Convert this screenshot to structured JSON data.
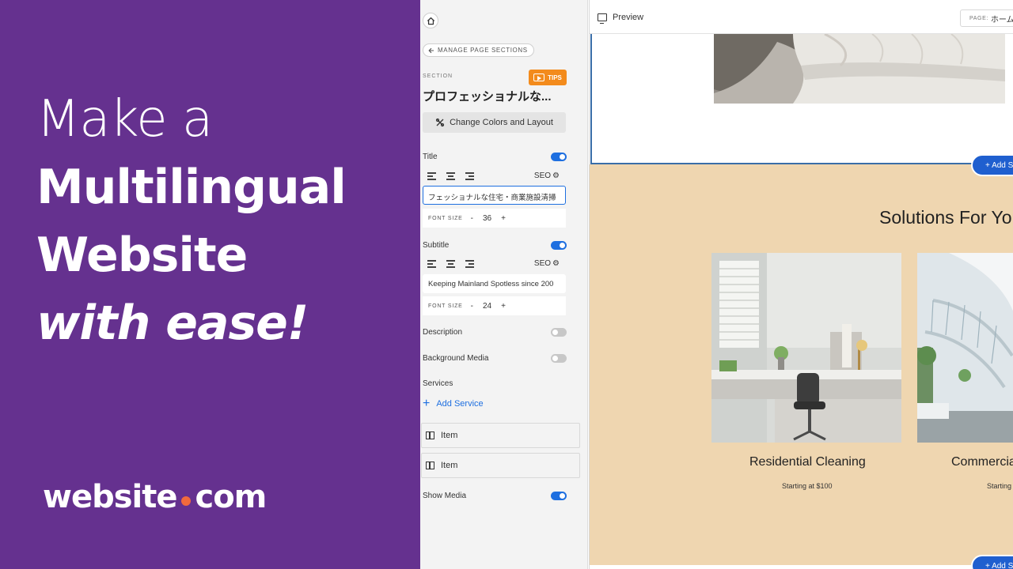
{
  "promo": {
    "line1": "Make a",
    "line2": "Multilingual",
    "line3": "Website",
    "line4": "with ease!",
    "brand_left": "website",
    "brand_right": "com"
  },
  "editor": {
    "manage_label": "MANAGE PAGE SECTIONS",
    "section_label": "SECTION",
    "tips_label": "TIPS",
    "section_title": "プロフェッショナルな...",
    "colors_layout_label": "Change Colors and Layout",
    "title_label": "Title",
    "title_value": "フェッショナルな住宅・商業施設清掃",
    "subtitle_label": "Subtitle",
    "subtitle_value": "Keeping Mainland Spotless since 200",
    "seo_label": "SEO",
    "font_size_label": "FONT SIZE",
    "minus": "-",
    "plus": "+",
    "title_font_size": "36",
    "subtitle_font_size": "24",
    "description_label": "Description",
    "background_media_label": "Background Media",
    "services_label": "Services",
    "add_service_label": "Add Service",
    "item1_label": "Item",
    "item2_label": "Item",
    "show_media_label": "Show Media",
    "toggles": {
      "title": true,
      "subtitle": true,
      "description": false,
      "background_media": false,
      "show_media": true
    }
  },
  "preview": {
    "label": "Preview",
    "page_key": "PAGE:",
    "page_value": "ホーム",
    "add_section_label": "+ Add S",
    "solutions_title": "Solutions For You",
    "cards": [
      {
        "title": "Residential Cleaning",
        "price": "Starting at $100"
      },
      {
        "title": "Commercial",
        "price": "Starting at"
      }
    ]
  },
  "colors": {
    "promo_bg": "#65318f",
    "accent_blue": "#1e6fe0",
    "tips_orange": "#f38b1c",
    "section_bg": "#efd6b0",
    "brand_dot": "#f26a3d"
  },
  "icons": [
    "home-icon",
    "arrow-left-icon",
    "play-icon",
    "palette-icon",
    "gear-icon",
    "align-left-icon",
    "align-center-icon",
    "align-right-icon",
    "plus-icon",
    "item-columns-icon",
    "monitor-icon"
  ]
}
